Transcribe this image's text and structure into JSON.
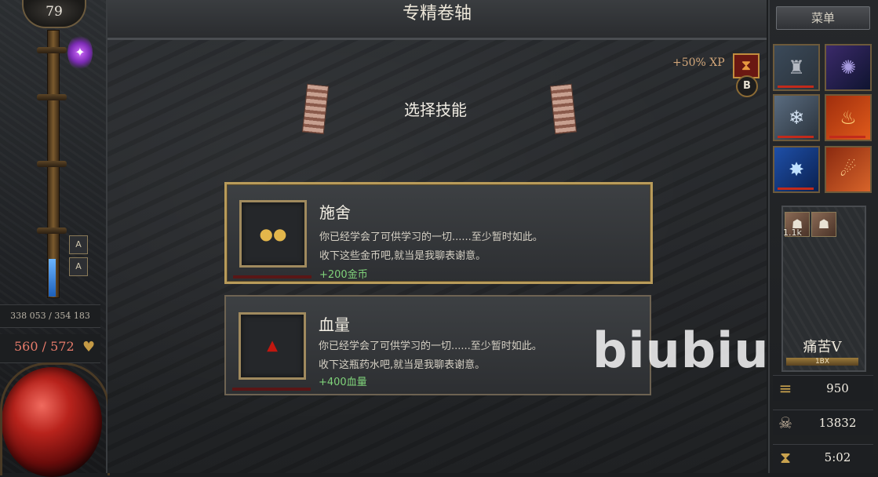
{
  "player": {
    "level": "79",
    "xp_text": "338 053 / 354 183",
    "hp_text": "560 / 572"
  },
  "left_skills": [
    "A",
    "A"
  ],
  "header": {
    "title": "专精卷轴"
  },
  "xp_boost": {
    "text": "+50% XP",
    "button_label": "B"
  },
  "main": {
    "subtitle": "选择技能",
    "options": [
      {
        "title": "施舍",
        "line1": "你已经学会了可供学习的一切......至少暂时如此。",
        "line2": "收下这些金币吧,就当是我聊表谢意。",
        "reward": "+200金币",
        "icon": "gold-coins-icon"
      },
      {
        "title": "血量",
        "line1": "你已经学会了可供学习的一切......至少暂时如此。",
        "line2": "收下这瓶药水吧,就当是我聊表谢意。",
        "reward": "+400血量",
        "icon": "blood-drop-icon"
      }
    ]
  },
  "watermark": "biubiu",
  "right": {
    "menu_label": "菜单",
    "skill_slots": [
      "golem-icon",
      "void-orb-icon",
      "ice-shards-icon",
      "flame-icon",
      "lightning-nova-icon",
      "meteor-icon"
    ],
    "minion_count": "1.1k",
    "difficulty": "痛苦V",
    "difficulty_sub": "1BX",
    "gold": "950",
    "kills": "13832",
    "time": "5:02"
  },
  "colors": {
    "accent_gold": "#b89b5a",
    "reward_green": "#7fd27a",
    "hp_red": "#e87c6b",
    "xp_boost": "#d3a77a"
  }
}
